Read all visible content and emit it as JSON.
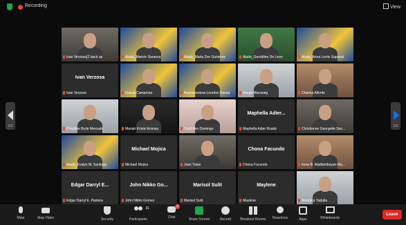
{
  "topbar": {
    "recording_label": "Recording",
    "view_label": "View"
  },
  "nav": {
    "left_page": "1/2",
    "right_page": "1/2"
  },
  "tiles": [
    {
      "label": "Ivan Verzosa(2 back up",
      "center": "",
      "video": "bg-room"
    },
    {
      "label": "Aludo_Marivic Saranza",
      "center": "",
      "video": "bg-blue",
      "speaking": true
    },
    {
      "label": "Aludo_Maria Zoe Gutierrez",
      "center": "",
      "video": "bg-blue"
    },
    {
      "label": "Aludo_Geraldine De Leon",
      "center": "",
      "video": "bg-green"
    },
    {
      "label": "Aludo_Anna Lorrie Saponal",
      "center": "",
      "video": "bg-blue"
    },
    {
      "label": "Ivan Verzosa",
      "center": "Ivan Verzosa",
      "video": ""
    },
    {
      "label": "Gracia Camarosa",
      "center": "",
      "video": "bg-blue"
    },
    {
      "label": "Buenaventura Lourdes Barala",
      "center": "",
      "video": "bg-blue"
    },
    {
      "label": "Marga Macaraig",
      "center": "",
      "video": "bg-light"
    },
    {
      "label": "Charisa Alfonte",
      "center": "",
      "video": "bg-warm"
    },
    {
      "label": "Christine Bryle Mercado",
      "center": "",
      "video": "bg-light"
    },
    {
      "label": "Mariah Kristel Aninias",
      "center": "",
      "video": "bg-dark"
    },
    {
      "label": "Cecil Ann Domingo",
      "center": "",
      "video": "bg-pink"
    },
    {
      "label": "Maphella Adier Ruado",
      "center": "Maphella Adier...",
      "video": ""
    },
    {
      "label": "Christianne Georgette Sen...",
      "center": "",
      "video": "bg-room"
    },
    {
      "label": "Aludo_Evalyn M. Santiago",
      "center": "",
      "video": "bg-blue"
    },
    {
      "label": "Michael Mojica",
      "center": "Michael Mojica",
      "video": ""
    },
    {
      "label": "Joan Yalan",
      "center": "",
      "video": "bg-room"
    },
    {
      "label": "Chona Facundo",
      "center": "Chona Facundo",
      "video": ""
    },
    {
      "label": "Irene B. Madlambayan-Mu...",
      "center": "",
      "video": "bg-warm"
    },
    {
      "label": "Edgar Darryl E. Pastera",
      "center": "Edgar Darryl E...",
      "video": ""
    },
    {
      "label": "John Nikko Gomez",
      "center": "John Nikko Go...",
      "video": ""
    },
    {
      "label": "Marisol Sulit",
      "center": "Marisol Sulit",
      "video": ""
    },
    {
      "label": "Maylene",
      "center": "Maylene",
      "video": ""
    },
    {
      "label": "Veronica Yadulla",
      "center": "",
      "video": "bg-light"
    }
  ],
  "toolbar": {
    "mute": "Mute",
    "stop_video": "Stop Video",
    "security": "Security",
    "participants": "Participants",
    "participants_count": "31",
    "chat": "Chat",
    "chat_badge": "2",
    "share_screen": "Share Screen",
    "record": "Record",
    "breakout_rooms": "Breakout Rooms",
    "reactions": "Reactions",
    "apps": "Apps",
    "whiteboards": "Whiteboards",
    "end": "Leave"
  }
}
